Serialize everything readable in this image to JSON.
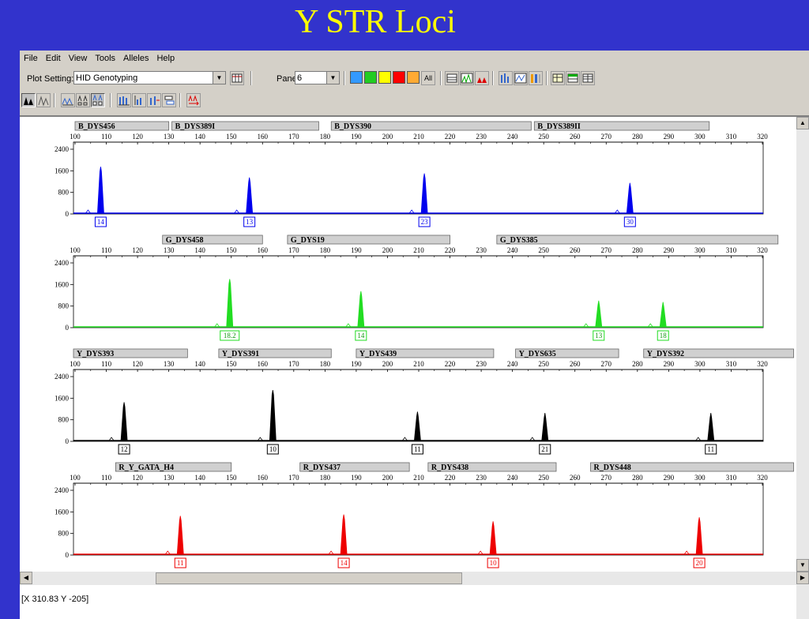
{
  "slide_title": "Y STR Loci",
  "menu": [
    "File",
    "Edit",
    "View",
    "Tools",
    "Alleles",
    "Help"
  ],
  "toolbar": {
    "plot_setting_label": "Plot Setting:",
    "plot_setting_value": "HID Genotyping",
    "panes_label": "Panes:",
    "panes_value": "6",
    "all_label": "All",
    "dye_colors": [
      "#3399ff",
      "#22cc22",
      "#ffff00",
      "#ff0000",
      "#ffaa33"
    ]
  },
  "status": "[X 310.83  Y -205]",
  "colors": {
    "blue": "#0000ee",
    "green": "#22dd22",
    "black": "#000000",
    "red": "#ee0000"
  },
  "chart_data": {
    "type": "electropherogram",
    "x_ticks": [
      100,
      110,
      120,
      130,
      140,
      150,
      160,
      170,
      180,
      190,
      200,
      210,
      220,
      230,
      240,
      250,
      260,
      270,
      280,
      290,
      300,
      310,
      320
    ],
    "y_ticks": [
      0,
      800,
      1600,
      2400
    ],
    "ylim": [
      0,
      2400
    ],
    "panes": [
      {
        "dye": "blue",
        "markers": [
          {
            "name": "B_DYS456",
            "start": 100,
            "end": 130
          },
          {
            "name": "B_DYS389I",
            "start": 131,
            "end": 178
          },
          {
            "name": "B_DYS390",
            "start": 182,
            "end": 246
          },
          {
            "name": "B_DYS389II",
            "start": 247,
            "end": 303
          }
        ],
        "peaks": [
          {
            "x": 108.2,
            "y": 1750,
            "allele": "14"
          },
          {
            "x": 155.8,
            "y": 1350,
            "allele": "13"
          },
          {
            "x": 211.8,
            "y": 1500,
            "allele": "23"
          },
          {
            "x": 277.6,
            "y": 1150,
            "allele": "30"
          }
        ]
      },
      {
        "dye": "green",
        "markers": [
          {
            "name": "G_DYS458",
            "start": 128,
            "end": 160
          },
          {
            "name": "G_DYS19",
            "start": 168,
            "end": 220
          },
          {
            "name": "G_DYS385",
            "start": 235,
            "end": 325
          }
        ],
        "peaks": [
          {
            "x": 149.5,
            "y": 1800,
            "allele": "18.2"
          },
          {
            "x": 191.5,
            "y": 1350,
            "allele": "14"
          },
          {
            "x": 267.6,
            "y": 1000,
            "allele": "13"
          },
          {
            "x": 288.2,
            "y": 950,
            "allele": "18"
          }
        ]
      },
      {
        "dye": "black",
        "markers": [
          {
            "name": "Y_DYS393",
            "start": 98,
            "end": 136
          },
          {
            "name": "Y_DYS391",
            "start": 146,
            "end": 182
          },
          {
            "name": "Y_DYS439",
            "start": 190,
            "end": 234
          },
          {
            "name": "Y_DYS635",
            "start": 241,
            "end": 274
          },
          {
            "name": "Y_DYS392",
            "start": 282,
            "end": 330
          }
        ],
        "peaks": [
          {
            "x": 115.7,
            "y": 1450,
            "allele": "12"
          },
          {
            "x": 163.3,
            "y": 1900,
            "allele": "10"
          },
          {
            "x": 209.6,
            "y": 1100,
            "allele": "11"
          },
          {
            "x": 250.4,
            "y": 1050,
            "allele": "21"
          },
          {
            "x": 303.5,
            "y": 1050,
            "allele": "11"
          }
        ]
      },
      {
        "dye": "red",
        "markers": [
          {
            "name": "R_Y_GATA_H4",
            "start": 113,
            "end": 150
          },
          {
            "name": "R_DYS437",
            "start": 172,
            "end": 207
          },
          {
            "name": "R_DYS438",
            "start": 213,
            "end": 254
          },
          {
            "name": "R_DYS448",
            "start": 265,
            "end": 330
          }
        ],
        "peaks": [
          {
            "x": 133.7,
            "y": 1450,
            "allele": "11"
          },
          {
            "x": 186.0,
            "y": 1500,
            "allele": "14"
          },
          {
            "x": 233.8,
            "y": 1250,
            "allele": "10"
          },
          {
            "x": 299.8,
            "y": 1400,
            "allele": "20"
          }
        ]
      }
    ]
  }
}
